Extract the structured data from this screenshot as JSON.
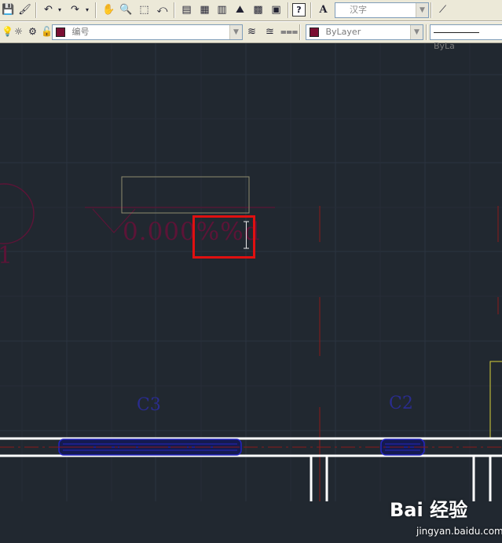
{
  "toolbar_top": {
    "text_style_value": "汉字",
    "icons": [
      "save-icon",
      "match-properties-icon",
      "undo-icon",
      "redo-icon",
      "pan-icon",
      "zoom-realtime-icon",
      "zoom-window-icon",
      "zoom-previous-icon",
      "properties-icon",
      "design-center-icon",
      "tool-palettes-icon",
      "sheet-set-icon",
      "markup-icon",
      "calculator-icon",
      "help-icon",
      "text-style-icon",
      "dim-style-icon"
    ]
  },
  "toolbar_layers": {
    "layer_name": "编号",
    "color_value": "ByLayer",
    "linetype_value": "ByLa",
    "icons": [
      "layer-on-icon",
      "freeze-icon",
      "lock-icon",
      "layer-color-icon",
      "layer-properties-icon",
      "make-current-icon",
      "layer-previous-icon"
    ]
  },
  "drawing": {
    "dim_text": "0.000%%d",
    "circle_label": "1",
    "labels": [
      "C3",
      "C2"
    ]
  },
  "colors": {
    "canvas_bg": "#212830",
    "layer_color": "#7a0f33",
    "window_blue": "#1c1ca8",
    "highlight": "#e01010"
  },
  "watermark": {
    "brand": "Bai 经验",
    "site": "jingyan.baidu.com"
  }
}
